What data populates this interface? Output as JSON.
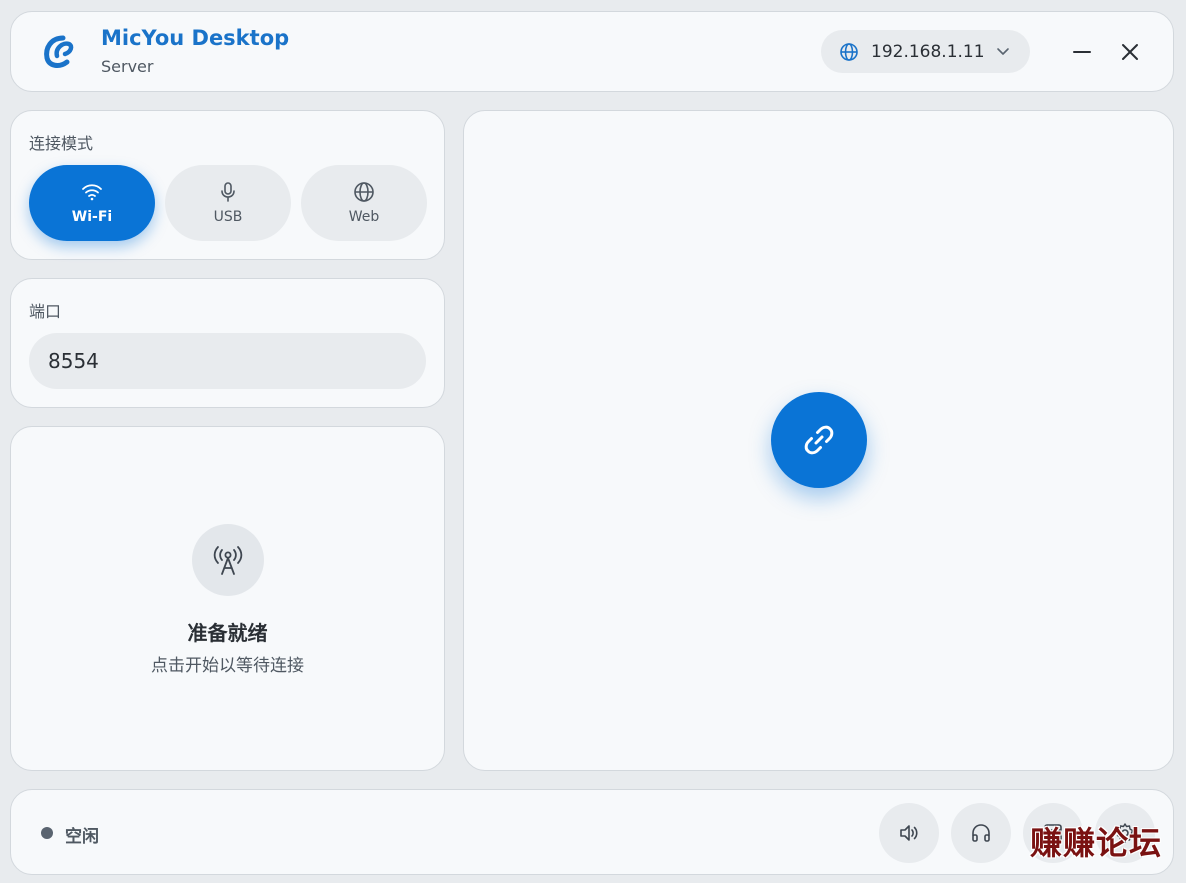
{
  "header": {
    "title": "MicYou Desktop",
    "subtitle": "Server",
    "ip_address": "192.168.1.11"
  },
  "connection_mode": {
    "label": "连接模式",
    "modes": [
      {
        "label": "Wi-Fi",
        "icon": "wifi-icon",
        "active": true
      },
      {
        "label": "USB",
        "icon": "microphone-icon",
        "active": false
      },
      {
        "label": "Web",
        "icon": "globe-icon",
        "active": false
      }
    ]
  },
  "port": {
    "label": "端口",
    "value": "8554"
  },
  "status_panel": {
    "icon": "antenna-tower-icon",
    "title": "准备就绪",
    "hint": "点击开始以等待连接"
  },
  "main": {
    "connect_icon": "link-icon"
  },
  "footer": {
    "status": "空闲",
    "buttons": [
      "speaker-icon",
      "headphones-icon",
      "window-icon",
      "gear-icon"
    ]
  },
  "watermark": "赚赚论坛",
  "colors": {
    "accent": "#0a74d6",
    "title": "#1a73c9",
    "background": "#e8ebee",
    "card": "#f7f9fb"
  }
}
